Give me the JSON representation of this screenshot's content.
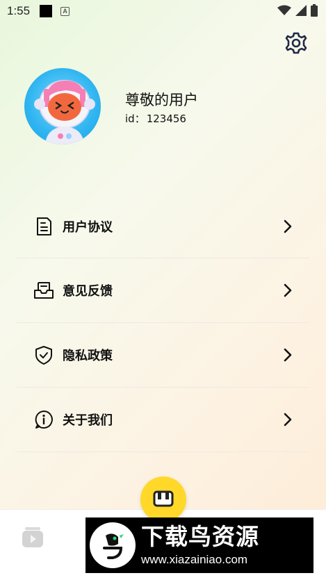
{
  "status_bar": {
    "time": "1:55",
    "a_badge": "A"
  },
  "profile": {
    "name": "尊敬的用户",
    "id_label": "id：",
    "id_value": "123456"
  },
  "menu": {
    "items": [
      {
        "label": "用户协议",
        "icon": "document-icon"
      },
      {
        "label": "意见反馈",
        "icon": "feedback-inbox-icon"
      },
      {
        "label": "隐私政策",
        "icon": "shield-check-icon"
      },
      {
        "label": "关于我们",
        "icon": "info-icon"
      }
    ]
  },
  "watermark": {
    "title": "下载鸟资源",
    "url": "www.xiazainiao.com"
  },
  "colors": {
    "accent": "#ffd82a",
    "text": "#111111",
    "divider": "#ece9e2"
  }
}
